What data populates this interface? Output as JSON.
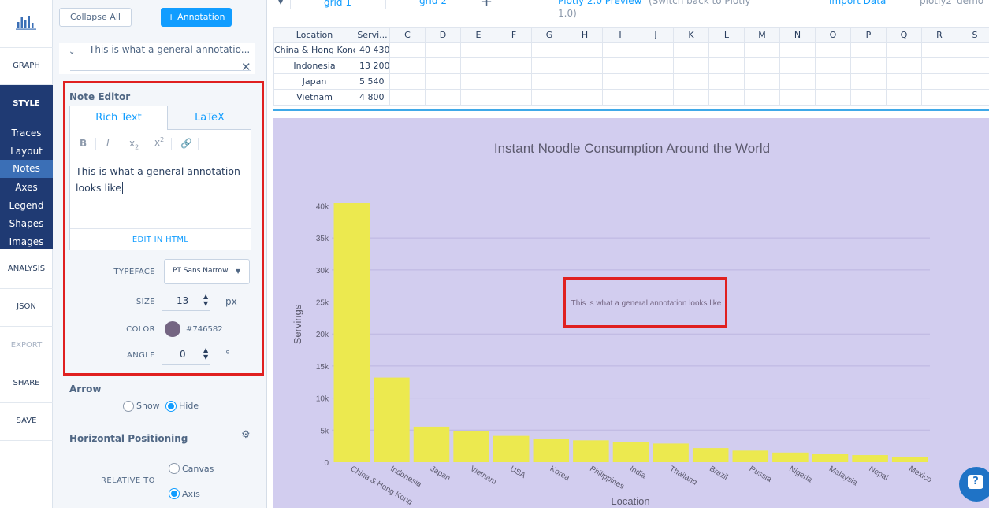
{
  "nav": {
    "graph": "GRAPH",
    "style": "STYLE",
    "style_items": [
      "Traces",
      "Layout",
      "Notes",
      "Axes",
      "Legend",
      "Shapes",
      "Images"
    ],
    "analysis": "ANALYSIS",
    "json": "JSON",
    "export": "EXPORT",
    "share": "SHARE",
    "save": "SAVE"
  },
  "panel": {
    "collapse_all": "Collapse All",
    "add_annotation": "+ Annotation",
    "annotation_title": "This is what a general annotatio...",
    "note_editor_label": "Note Editor",
    "tabs": [
      "Rich Text",
      "LaTeX"
    ],
    "toolbar": {
      "bold": "B",
      "italic": "I",
      "sub": "x2",
      "sup": "x2"
    },
    "editor_line1": "This is what a general annotation",
    "editor_line2": "looks like",
    "edit_html": "EDIT IN HTML",
    "typeface_label": "TYPEFACE",
    "typeface_value": "PT Sans Narrow",
    "size_label": "SIZE",
    "size_value": "13",
    "size_unit": "px",
    "color_label": "COLOR",
    "color_value": "#746582",
    "angle_label": "ANGLE",
    "angle_value": "0",
    "angle_unit": "°",
    "arrow_label": "Arrow",
    "arrow_show": "Show",
    "arrow_hide": "Hide",
    "horiz_label": "Horizontal Positioning",
    "relative_to_label": "RELATIVE TO",
    "relative_canvas": "Canvas",
    "relative_axis": "Axis"
  },
  "top_bar": {
    "grid1": "grid 1",
    "grid2": "grid 2",
    "preview": "Plotly 2.0 Preview",
    "switch_back": "(Switch back to Plotly",
    "switch_back2": "1.0)",
    "import": "Import Data",
    "user": "plotly2_demo"
  },
  "grid": {
    "headers": [
      "Location",
      "Servi...",
      "C",
      "D",
      "E",
      "F",
      "G",
      "H",
      "I",
      "J",
      "K",
      "L",
      "M",
      "N",
      "O",
      "P",
      "Q",
      "R",
      "S"
    ],
    "rows": [
      [
        "China & Hong Kong",
        "40 430"
      ],
      [
        "Indonesia",
        "13 200"
      ],
      [
        "Japan",
        "5 540"
      ],
      [
        "Vietnam",
        "4 800"
      ]
    ]
  },
  "colors": {
    "accent": "#119dff",
    "nav_dark": "#1f3a73",
    "plot_bg": "#d2cdef",
    "bar": "#ece94f",
    "annotation": "#746582",
    "highlight": "#e02020"
  },
  "chart_data": {
    "type": "bar",
    "title": "Instant Noodle Consumption Around the World",
    "xlabel": "Location",
    "ylabel": "Servings",
    "categories": [
      "China & Hong Kong",
      "Indonesia",
      "Japan",
      "Vietnam",
      "USA",
      "Korea",
      "Philippines",
      "India",
      "Thailand",
      "Brazil",
      "Russia",
      "Nigeria",
      "Malaysia",
      "Nepal",
      "Mexico"
    ],
    "values": [
      40430,
      13200,
      5540,
      4800,
      4100,
      3600,
      3400,
      3100,
      2900,
      2200,
      1800,
      1500,
      1300,
      1100,
      800
    ],
    "ylim": [
      0,
      40430
    ],
    "yticks": [
      0,
      5000,
      10000,
      15000,
      20000,
      25000,
      30000,
      35000,
      40000
    ],
    "ytick_labels": [
      "0",
      "5k",
      "10k",
      "15k",
      "20k",
      "25k",
      "30k",
      "35k",
      "40k"
    ],
    "grid": true,
    "annotation": "This is what a general annotation looks like"
  }
}
